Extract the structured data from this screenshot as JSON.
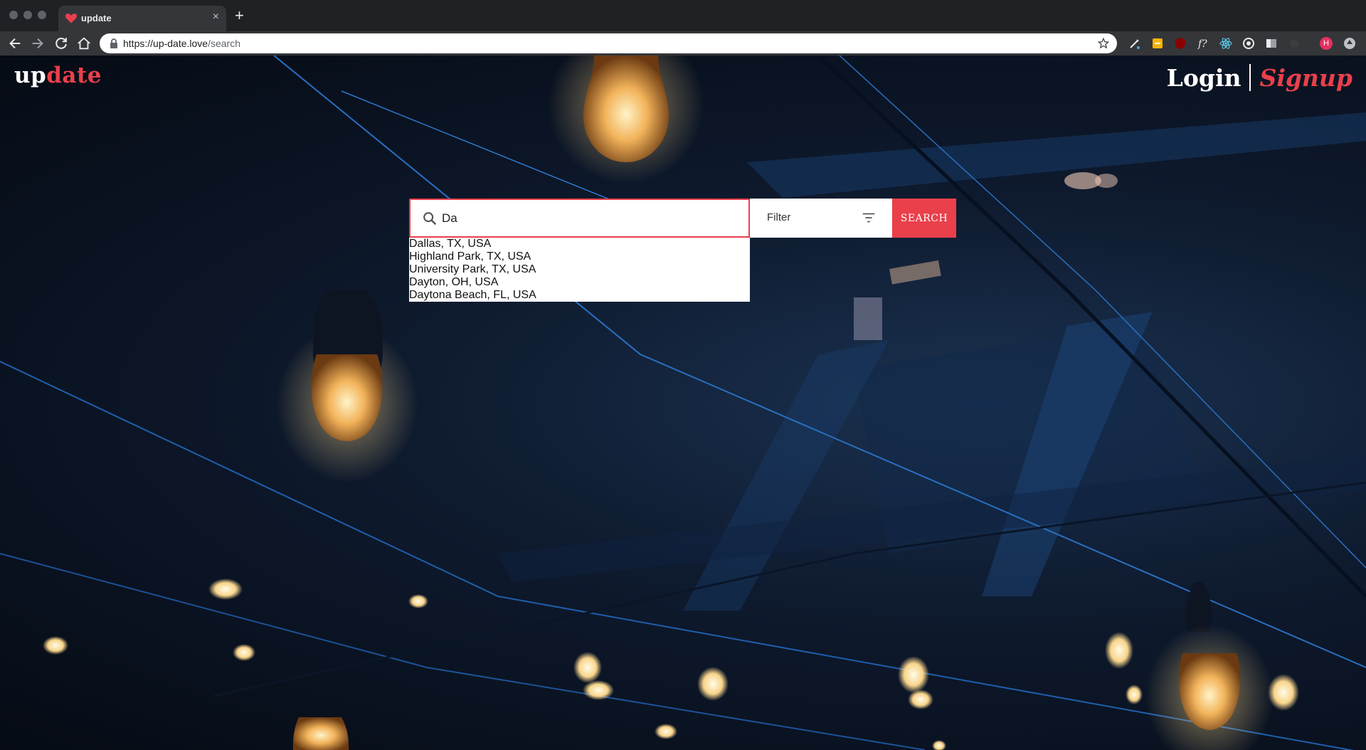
{
  "browser": {
    "tab": {
      "title": "update",
      "favicon": "heart-icon",
      "favicon_color": "#e9404b"
    },
    "url": {
      "scheme": "https://",
      "host": "up-date.love",
      "path": "/search"
    },
    "icons": [
      "back-icon",
      "forward-icon",
      "reload-icon",
      "home-icon",
      "lock-icon",
      "star-icon"
    ],
    "profile_initial": "H"
  },
  "page": {
    "logo": {
      "part1": "up",
      "part2": "date"
    },
    "auth": {
      "login_label": "Login",
      "signup_label": "Signup"
    },
    "search": {
      "value": "Da",
      "filter_label": "Filter",
      "button_label": "SEARCH",
      "suggestions": [
        "Dallas, TX, USA",
        "Highland Park, TX, USA",
        "University Park, TX, USA",
        "Dayton, OH, USA",
        "Daytona Beach, FL, USA"
      ]
    }
  },
  "colors": {
    "accent": "#e9404b",
    "chrome_dark": "#202124",
    "chrome_toolbar": "#35363a"
  }
}
